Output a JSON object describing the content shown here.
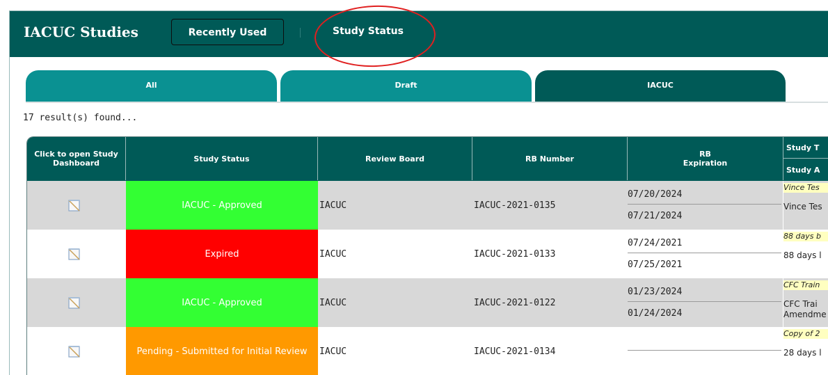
{
  "header": {
    "title": "IACUC Studies",
    "recently_used": "Recently Used",
    "study_status": "Study Status"
  },
  "tabs": [
    {
      "label": "All"
    },
    {
      "label": "Draft"
    },
    {
      "label": "IACUC"
    }
  ],
  "results_text": "17 result(s) found...",
  "table": {
    "columns": {
      "dashboard": "Click to open Study Dashboard",
      "status": "Study Status",
      "board": "Review Board",
      "rb_number": "RB Number",
      "rb_expiration_1": "RB",
      "rb_expiration_2": "Expiration",
      "study_t": "Study T",
      "study_a": "Study A"
    },
    "rows": [
      {
        "status": "IACUC - Approved",
        "board": "IACUC",
        "rb_number": "IACUC-2021-0135",
        "date1": "07/20/2024",
        "date2": "07/21/2024",
        "note": "Vince Tes",
        "title": "Vince Tes",
        "title2": ""
      },
      {
        "status": "Expired",
        "board": "IACUC",
        "rb_number": "IACUC-2021-0133",
        "date1": "07/24/2021",
        "date2": "07/25/2021",
        "note": "88 days b",
        "title": "88 days l",
        "title2": ""
      },
      {
        "status": "IACUC - Approved",
        "board": "IACUC",
        "rb_number": "IACUC-2021-0122",
        "date1": "01/23/2024",
        "date2": "01/24/2024",
        "note": "CFC Train",
        "title": "CFC Trai",
        "title2": "Amendme"
      },
      {
        "status": "Pending - Submitted for Initial Review",
        "board": "IACUC",
        "rb_number": "IACUC-2021-0134",
        "date1": "",
        "date2": "",
        "note": "Copy of 2",
        "title": "28 days l",
        "title2": ""
      }
    ]
  },
  "colors": {
    "header": "#005a57",
    "tab_active": "#005a57",
    "tab_inactive": "#0a9192",
    "approved": "#33ff33",
    "expired": "#ff0000",
    "pending": "#ff9900",
    "annotation_circle": "#e02020"
  },
  "icons": {
    "dashboard_link": "notepad-icon"
  }
}
